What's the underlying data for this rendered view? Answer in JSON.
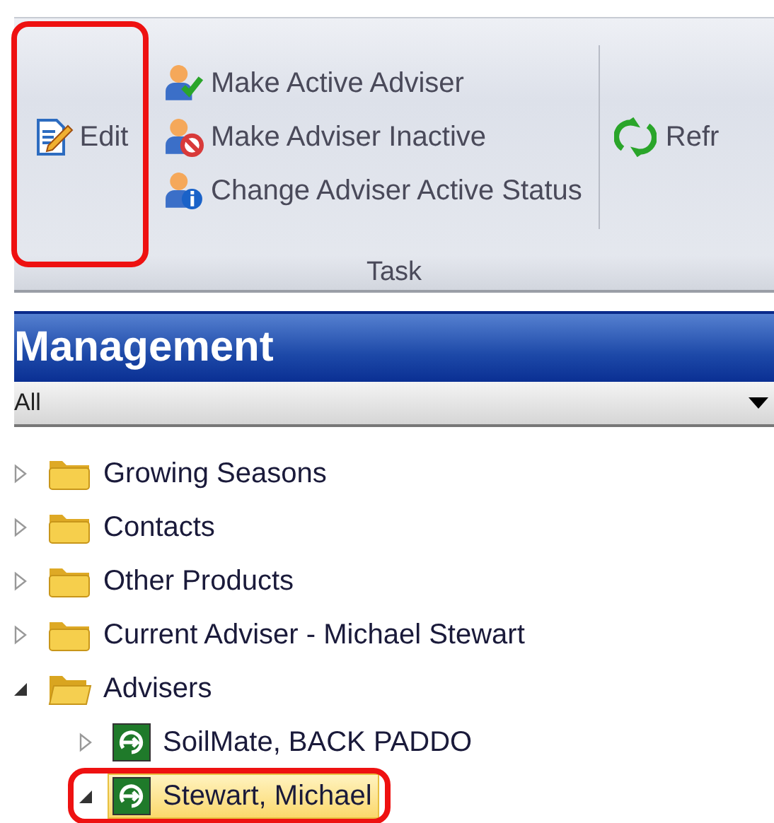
{
  "ribbon": {
    "edit": {
      "label": "Edit",
      "highlighted": true
    },
    "actions": [
      {
        "label": "Make Active Adviser",
        "kind": "activate"
      },
      {
        "label": "Make Adviser Inactive",
        "kind": "deactivate"
      },
      {
        "label": "Change Adviser Active Status",
        "kind": "status"
      }
    ],
    "refresh": {
      "label": "Refr"
    },
    "group_label": "Task"
  },
  "panel": {
    "title": "Management",
    "filter": {
      "value": "All"
    }
  },
  "tree": [
    {
      "label": "Growing Seasons",
      "kind": "folder",
      "expanded": false,
      "selected": false,
      "highlighted": false
    },
    {
      "label": "Contacts",
      "kind": "folder",
      "expanded": false,
      "selected": false,
      "highlighted": false
    },
    {
      "label": "Other Products",
      "kind": "folder",
      "expanded": false,
      "selected": false,
      "highlighted": false
    },
    {
      "label": "Current Adviser - Michael Stewart",
      "kind": "folder",
      "expanded": false,
      "selected": false,
      "highlighted": false
    },
    {
      "label": "Advisers",
      "kind": "folder",
      "expanded": true,
      "selected": false,
      "highlighted": false,
      "children": [
        {
          "label": "SoilMate, BACK PADDO",
          "kind": "adviser",
          "expanded": false,
          "selected": false,
          "highlighted": false
        },
        {
          "label": "Stewart, Michael",
          "kind": "adviser",
          "expanded": true,
          "selected": true,
          "highlighted": true
        }
      ]
    }
  ]
}
